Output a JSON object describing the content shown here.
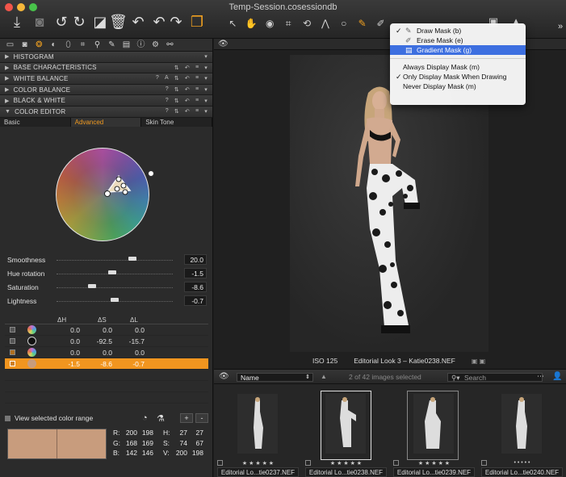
{
  "window": {
    "title": "Temp-Session.cosessiondb"
  },
  "tool_headers": [
    {
      "label": "HISTOGRAM",
      "arrow": "▶"
    },
    {
      "label": "BASE CHARACTERISTICS",
      "arrow": "▶"
    },
    {
      "label": "WHITE BALANCE",
      "arrow": "▶",
      "ctrl1": "?",
      "ctrl2": "A"
    },
    {
      "label": "COLOR BALANCE",
      "arrow": "▶",
      "ctrl1": "?"
    },
    {
      "label": "BLACK & WHITE",
      "arrow": "▶",
      "ctrl1": "?"
    },
    {
      "label": "COLOR EDITOR",
      "arrow": "▼",
      "ctrl1": "?"
    }
  ],
  "sub_tabs": [
    "Basic",
    "Advanced",
    "Skin Tone"
  ],
  "sliders": [
    {
      "label": "Smoothness",
      "value": "20.0",
      "pos": 0.62
    },
    {
      "label": "Hue rotation",
      "value": "-1.5",
      "pos": 0.47
    },
    {
      "label": "Saturation",
      "value": "-8.6",
      "pos": 0.3
    },
    {
      "label": "Lightness",
      "value": "-0.7",
      "pos": 0.49
    }
  ],
  "color_table": {
    "headers": [
      "ΔH",
      "ΔS",
      "ΔL"
    ],
    "rows": [
      {
        "dh": "0.0",
        "ds": "0.0",
        "dl": "0.0",
        "swatch": "#c070d0"
      },
      {
        "dh": "0.0",
        "ds": "-92.5",
        "dl": "-15.7",
        "swatch": "#111111"
      },
      {
        "dh": "0.0",
        "ds": "0.0",
        "dl": "0.0",
        "swatch": "#c070d0"
      },
      {
        "dh": "-1.5",
        "ds": "-8.6",
        "dl": "-0.7",
        "swatch": "#c89c7d"
      }
    ]
  },
  "view_range": {
    "label": "View selected color range",
    "plus": "+",
    "minus": "-"
  },
  "readout": {
    "rows": [
      {
        "a": "R:",
        "b": "200",
        "c": "198",
        "d": "H:",
        "e": "27",
        "f": "27"
      },
      {
        "a": "G:",
        "b": "168",
        "c": "169",
        "d": "S:",
        "e": "74",
        "f": "67"
      },
      {
        "a": "B:",
        "b": "142",
        "c": "146",
        "d": "V:",
        "e": "200",
        "f": "198"
      }
    ],
    "swatch_color": "#c89c7d"
  },
  "viewer": {
    "iso": "ISO 125",
    "caption": "Editorial Look 3 – Katie0238.NEF"
  },
  "menu": {
    "items": [
      {
        "label": "Draw Mask (b)",
        "check": "✓",
        "icon": "✎"
      },
      {
        "label": "Erase Mask (e)",
        "check": "",
        "icon": "✐"
      },
      {
        "label": "Gradient Mask (g)",
        "check": "",
        "icon": "▤"
      }
    ],
    "display_items": [
      {
        "label": "Always Display Mask (m)",
        "check": ""
      },
      {
        "label": "Only Display Mask When Drawing",
        "check": "✓"
      },
      {
        "label": "Never Display Mask (m)",
        "check": ""
      }
    ]
  },
  "browser": {
    "sort_label": "Name",
    "count": "2 of 42 images selected",
    "search_placeholder": "Search",
    "thumbs": [
      {
        "name": "Editorial Lo...tie0237.NEF",
        "stars": "★ ★ ★ ★ ★"
      },
      {
        "name": "Editorial Lo...tie0238.NEF",
        "stars": "★ ★ ★ ★ ★"
      },
      {
        "name": "Editorial Lo...tie0239.NEF",
        "stars": "★ ★ ★ ★ ★"
      },
      {
        "name": "Editorial Lo...tie0240.NEF",
        "stars": "• • • • •"
      }
    ]
  }
}
